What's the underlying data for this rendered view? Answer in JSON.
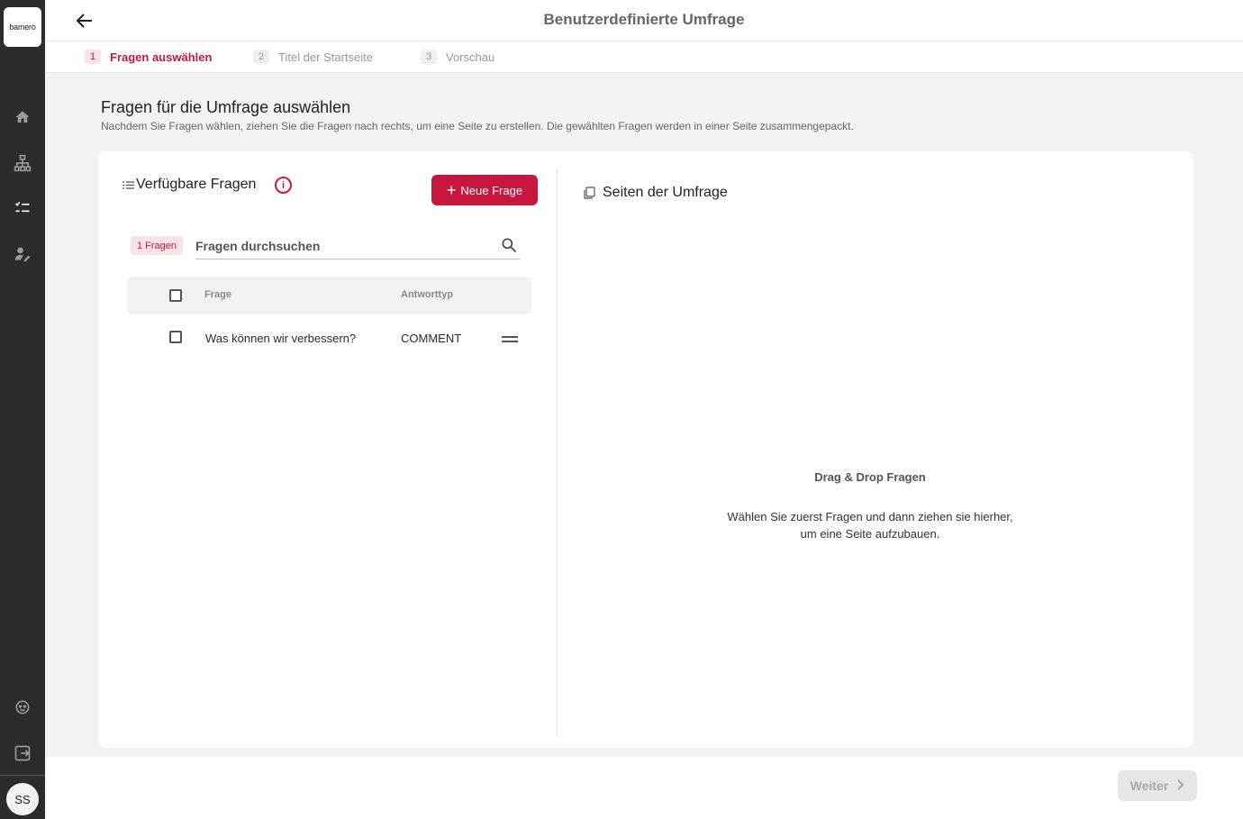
{
  "sidebar": {
    "logo_text": "bamero",
    "user_initials": "SS"
  },
  "header": {
    "title": "Benutzerdefinierte Umfrage"
  },
  "stepper": {
    "steps": [
      {
        "number": "1",
        "label": "Fragen auswählen",
        "state": "active"
      },
      {
        "number": "2",
        "label": "Titel der Startseite",
        "state": "inactive"
      },
      {
        "number": "3",
        "label": "Vorschau",
        "state": "inactive"
      }
    ]
  },
  "page": {
    "title": "Fragen für die Umfrage auswählen",
    "subtitle": "Nachdem Sie Fragen wählen, ziehen Sie die Fragen nach rechts, um eine Seite zu erstellen. Die gewählten Fragen werden in einer Seite zusammengepackt."
  },
  "available": {
    "title": "Verfügbare Fragen",
    "new_button_label": "Neue Frage",
    "count_badge": "1 Fragen",
    "search_placeholder": "Fragen durchsuchen",
    "columns": {
      "question": "Frage",
      "answer_type": "Antworttyp"
    },
    "rows": [
      {
        "question": "Was können wir verbessern?",
        "answer_type": "COMMENT"
      }
    ]
  },
  "pages_panel": {
    "title": "Seiten der Umfrage",
    "dd_title": "Drag & Drop Fragen",
    "dd_text_line1": "Wählen Sie zuerst Fragen und dann ziehen sie hierher,",
    "dd_text_line2": "um eine Seite aufzubauen."
  },
  "footer": {
    "next_label": "Weiter"
  },
  "colors": {
    "accent": "#c8173f",
    "sidebar_bg": "#2c2c2e",
    "page_bg": "#f2f2f3"
  },
  "icons": [
    "home-icon",
    "sitemap-icon",
    "checklist-icon",
    "user-edit-icon",
    "support-icon",
    "logout-icon",
    "back-arrow-icon",
    "info-icon",
    "search-icon",
    "chevron-down-icon",
    "drag-handle-icon",
    "pages-icon",
    "clipboard-illustration"
  ]
}
